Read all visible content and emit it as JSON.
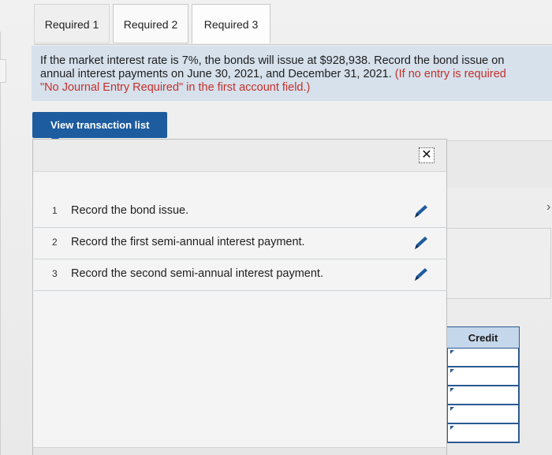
{
  "tabs": [
    {
      "label": "Required 1"
    },
    {
      "label": "Required 2"
    },
    {
      "label": "Required 3"
    }
  ],
  "instructions": {
    "line1": "If the market interest rate is 7%, the bonds will issue at $928,938. Record the bond issue on",
    "line2_black": "annual interest payments on June 30, 2021, and December 31, 2021.",
    "line2_red": " (If no entry is required",
    "line3_red": "\"No Journal Entry Required\" in the first account field.)"
  },
  "view_transaction_button": {
    "label": "View transaction list"
  },
  "transactions": [
    {
      "number": "1",
      "label": "Record the bond issue."
    },
    {
      "number": "2",
      "label": "Record the first semi-annual interest payment."
    },
    {
      "number": "3",
      "label": "Record the second semi-annual interest payment."
    }
  ],
  "journal": {
    "credit_header": "Credit"
  },
  "colors": {
    "accent": "#1d5c9e",
    "instruction_bg": "#d6e1ec",
    "red_note": "#c4302b"
  }
}
